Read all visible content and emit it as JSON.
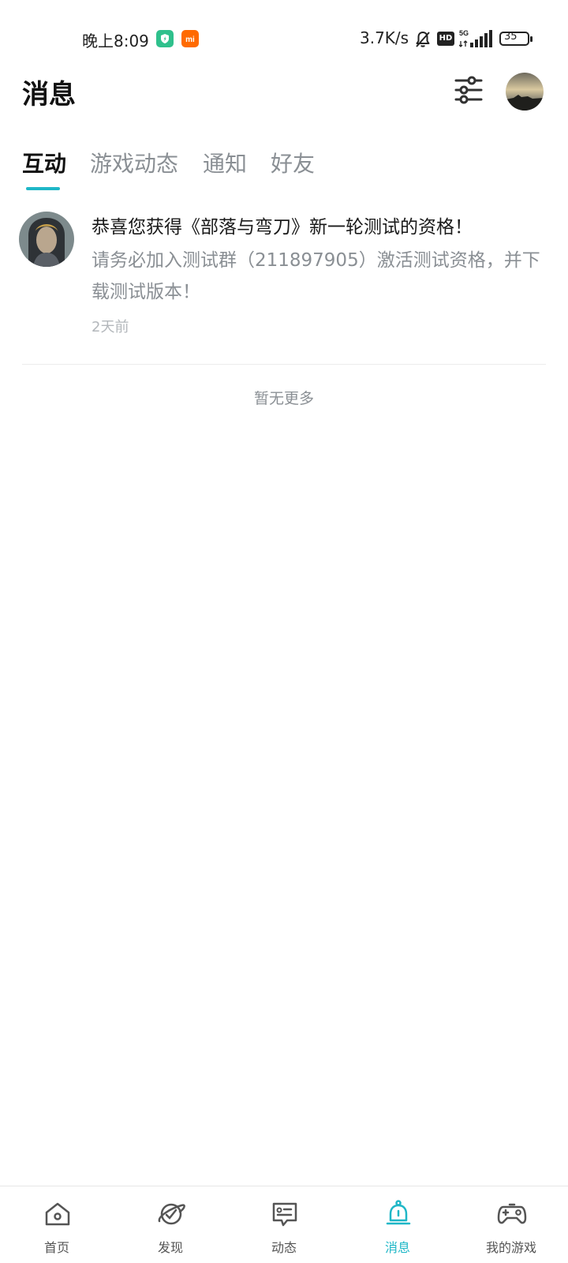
{
  "status_bar": {
    "time": "晚上8:09",
    "network_speed": "3.7K/s",
    "hd_label": "HD",
    "network_type": "5G",
    "battery_level": "35"
  },
  "header": {
    "title": "消息",
    "filter_icon": "sliders-icon",
    "avatar_icon": "user-avatar"
  },
  "tabs": [
    {
      "label": "互动",
      "active": true
    },
    {
      "label": "游戏动态",
      "active": false
    },
    {
      "label": "通知",
      "active": false
    },
    {
      "label": "好友",
      "active": false
    }
  ],
  "messages": [
    {
      "title": "恭喜您获得《部落与弯刀》新一轮测试的资格！",
      "body": "请务必加入测试群（211897905）激活测试资格，并下载测试版本！",
      "time": "2天前"
    }
  ],
  "list_footer": "暂无更多",
  "bottom_nav": [
    {
      "label": "首页",
      "icon": "home-icon",
      "active": false
    },
    {
      "label": "发现",
      "icon": "planet-icon",
      "active": false
    },
    {
      "label": "动态",
      "icon": "chat-card-icon",
      "active": false
    },
    {
      "label": "消息",
      "icon": "bell-icon",
      "active": true
    },
    {
      "label": "我的游戏",
      "icon": "gamepad-icon",
      "active": false
    }
  ],
  "colors": {
    "accent": "#1fb7c7",
    "text_primary": "#1a1a1a",
    "text_secondary": "#8a8f94"
  }
}
